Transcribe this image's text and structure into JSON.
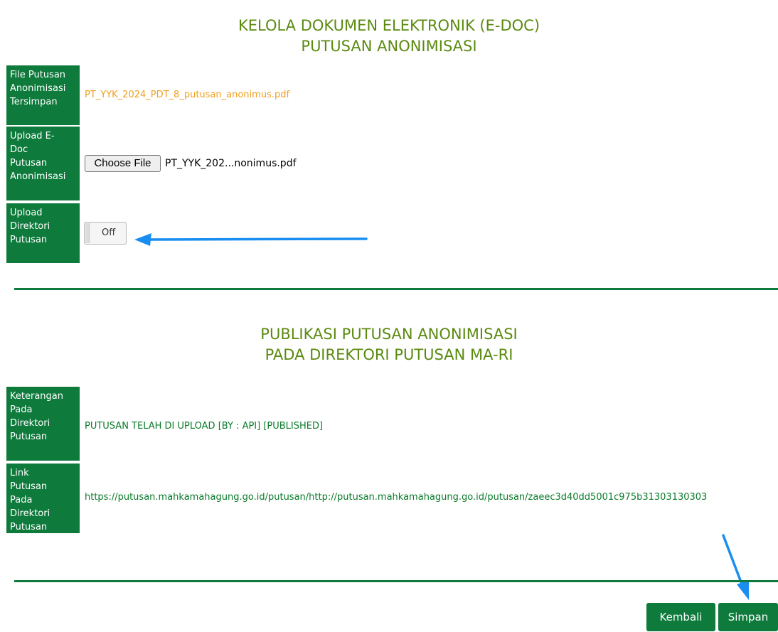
{
  "section1": {
    "title_line1": "KELOLA DOKUMEN ELEKTRONIK (E-DOC)",
    "title_line2": "PUTUSAN ANONIMISASI",
    "rows": {
      "file_saved": {
        "label_lines": [
          "File Putusan",
          "Anonimisasi",
          "Tersimpan"
        ],
        "value": "PT_YYK_2024_PDT_8_putusan_anonimus.pdf"
      },
      "upload_edoc": {
        "label_lines": [
          "Upload E-",
          "Doc",
          "Putusan",
          "Anonimisasi"
        ],
        "button_label": "Choose File",
        "file_name": "PT_YYK_202...nonimus.pdf"
      },
      "upload_direktori": {
        "label_lines": [
          "Upload",
          "Direktori",
          "Putusan"
        ],
        "toggle_state": "Off"
      }
    }
  },
  "section2": {
    "title_line1": "PUBLIKASI PUTUSAN ANONIMISASI",
    "title_line2": "PADA DIREKTORI PUTUSAN MA-RI",
    "rows": {
      "keterangan": {
        "label_lines": [
          "Keterangan",
          "Pada",
          "Direktori",
          "Putusan"
        ],
        "value": "PUTUSAN TELAH DI UPLOAD [BY : API] [PUBLISHED]"
      },
      "link": {
        "label_lines": [
          "Link",
          "Putusan",
          "Pada",
          "Direktori",
          "Putusan"
        ],
        "value": "https://putusan.mahkamahagung.go.id/putusan/http://putusan.mahkamahagung.go.id/putusan/zaeec3d40dd5001c975b31303130303"
      }
    }
  },
  "actions": {
    "back_label": "Kembali",
    "save_label": "Simpan"
  },
  "colors": {
    "label_bg": "#0e7a3c",
    "title": "#5b8a10",
    "saved_file_text": "#f0a020",
    "info_text": "#0a7a2a",
    "annotation_arrow": "#1a8ef0"
  }
}
